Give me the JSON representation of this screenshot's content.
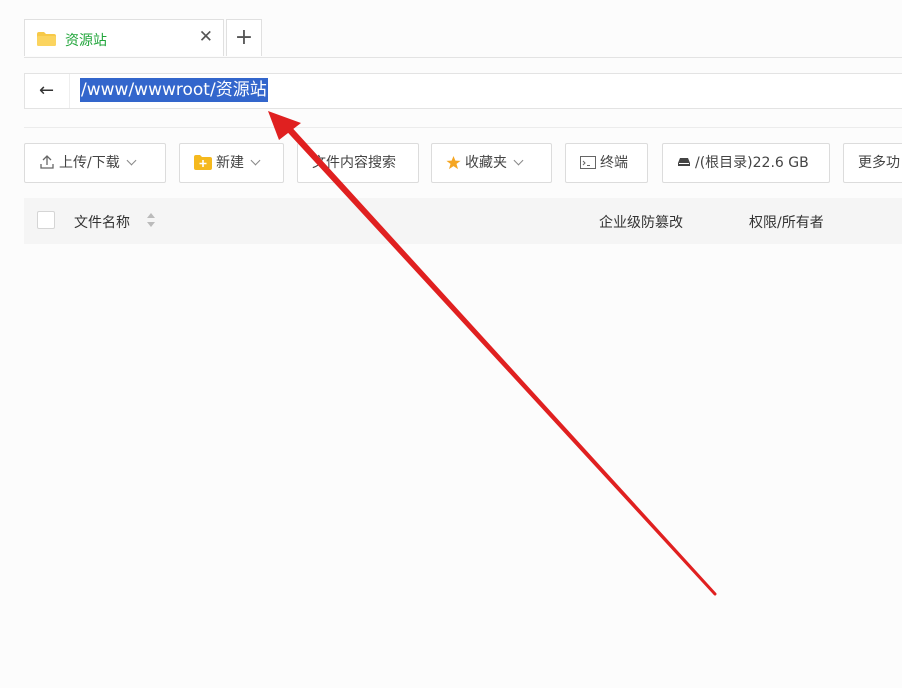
{
  "tabs": [
    {
      "label": "资源站"
    }
  ],
  "path": {
    "value": "/www/wwwroot/资源站"
  },
  "toolbar": {
    "upload": "上传/下载",
    "new": "新建",
    "search": "文件内容搜索",
    "favorites": "收藏夹",
    "terminal": "终端",
    "disk": "/(根目录)22.6 GB",
    "more": "更多功"
  },
  "table": {
    "headers": {
      "name": "文件名称",
      "tamper": "企业级防篡改",
      "perm": "权限/所有者"
    }
  },
  "annotation": {
    "color": "#e02020"
  },
  "colors": {
    "accent": "#20a53a",
    "selection": "#3366cc"
  }
}
